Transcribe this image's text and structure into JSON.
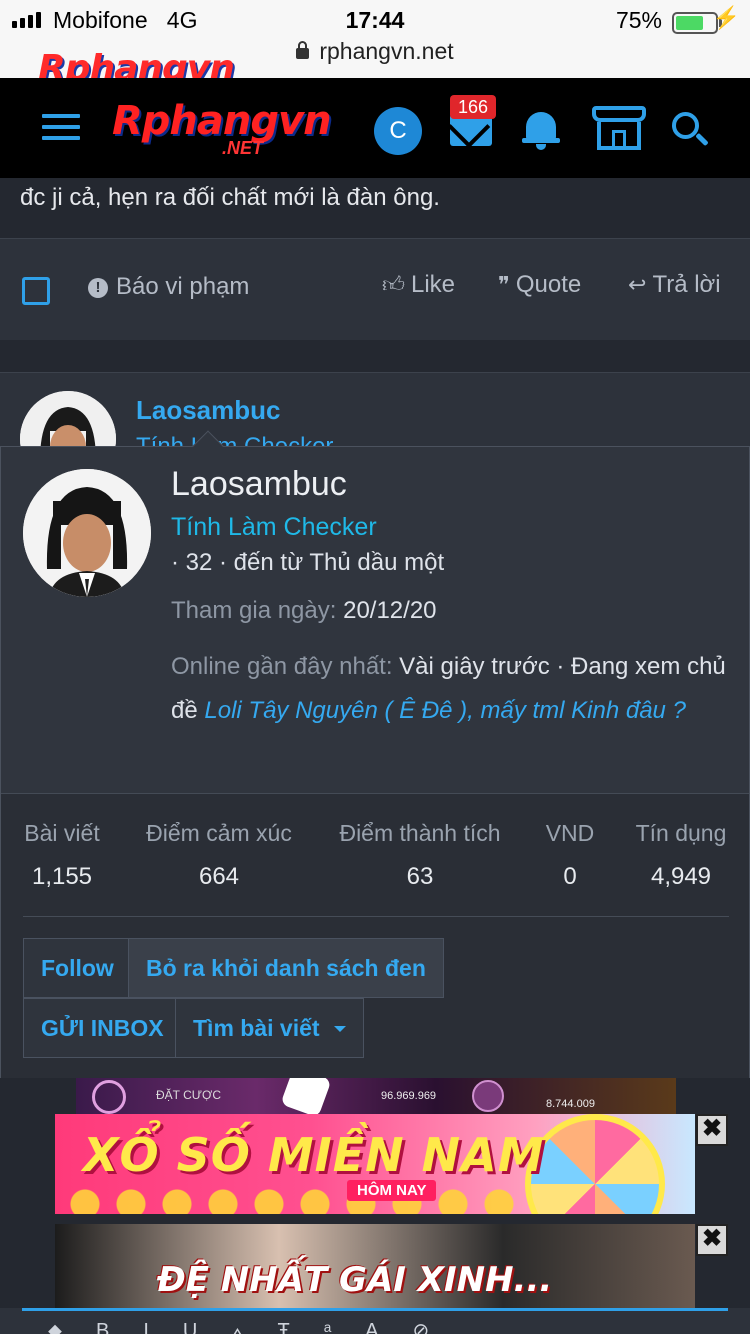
{
  "status_bar": {
    "carrier": "Mobifone",
    "network": "4G",
    "time": "17:44",
    "battery": "75%",
    "battery_level": 0.75,
    "url": "rphangvn.net"
  },
  "site": {
    "logo": "Rphangvn",
    "logo_suffix": ".NET",
    "user_initial": "C",
    "inbox_count": "166",
    "accent_color": "#2fa0e8"
  },
  "post": {
    "text_tail": "đc ji cả, hẹn ra đối chất mới là đàn ông.",
    "report_label": "Báo vi phạm",
    "like_label": "Like",
    "quote_label": "Quote",
    "reply_label": "Trả lời"
  },
  "next_post": {
    "author": "Laosambuc",
    "author_title": "Tính Làm Checker"
  },
  "member_card": {
    "name": "Laosambuc",
    "title": "Tính Làm Checker",
    "meta": "· 32 · đến từ Thủ dầu một",
    "joined_label": "Tham gia ngày:",
    "joined_value": "20/12/20",
    "online_label": "Online gần đây nhất:",
    "online_value": "Vài giây trước · Đang xem chủ đề",
    "online_thread": "Loli Tây Nguyên ( Ê Đê ), mấy tml Kinh đâu ?",
    "stats": [
      {
        "label": "Bài viết",
        "value": "1,155"
      },
      {
        "label": "Điểm cảm xúc",
        "value": "664"
      },
      {
        "label": "Điểm thành tích",
        "value": "63"
      },
      {
        "label": "VND",
        "value": "0"
      },
      {
        "label": "Tín dụng",
        "value": "4,949"
      }
    ],
    "buttons": {
      "follow": "Follow",
      "unblock": "Bỏ ra khỏi danh sách đen",
      "inbox": "GỬI INBOX",
      "find_posts": "Tìm bài viết"
    }
  },
  "ads": {
    "strip_texts": [
      "ĐẶT CƯỢC",
      "96.969.969",
      "8.744.009"
    ],
    "banner1_text": "XỔ SỐ MIỀN NAM",
    "banner1_sub": "HÔM NAY",
    "banner2_text": "ĐỆ NHẤT GÁI XINH...",
    "close_symbol": "✖"
  }
}
